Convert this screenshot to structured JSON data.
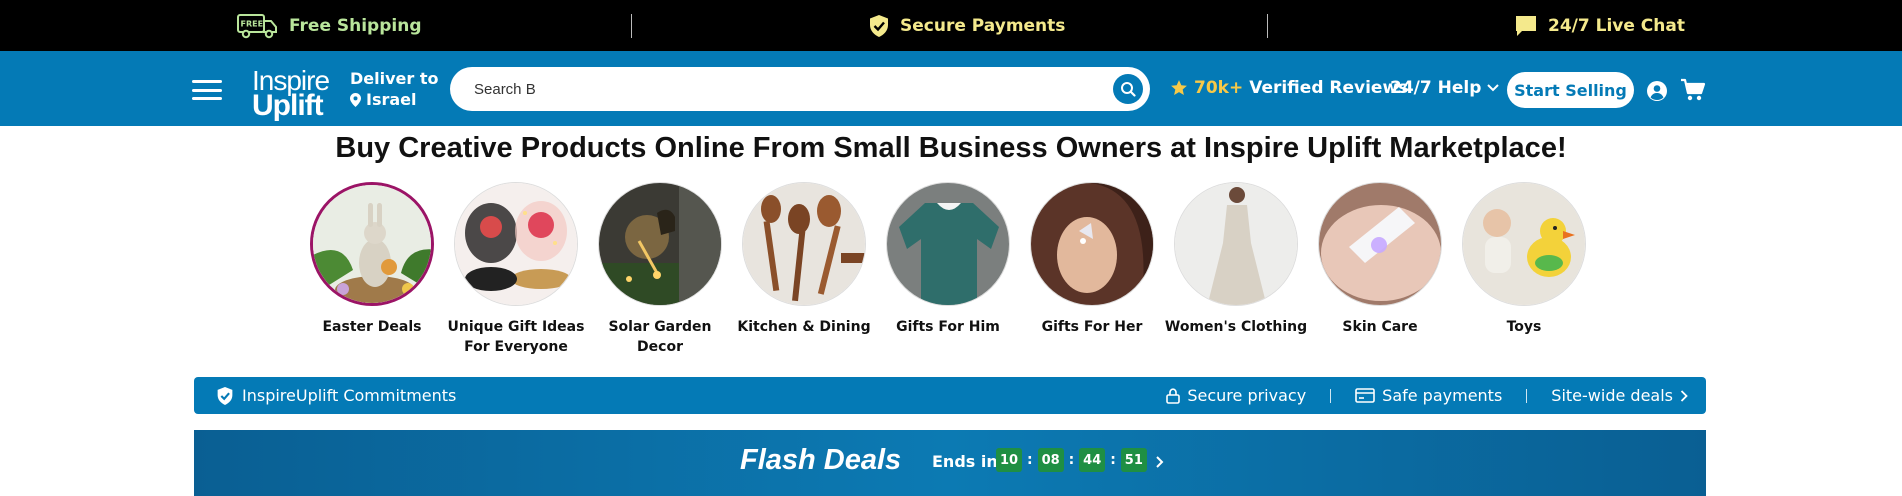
{
  "promo": {
    "free_badge": "FREE",
    "shipping": "Free Shipping",
    "secure": "Secure Payments",
    "chat": "24/7 Live Chat"
  },
  "header": {
    "logo_line1": "Inspire",
    "logo_line2": "Uplift",
    "deliver_label": "Deliver to",
    "deliver_country": "Israel",
    "search_value": "Search B",
    "reviews_count": "70k+",
    "reviews_label": "Verified Reviews",
    "help_label": "24/7 Help",
    "start_selling": "Start Selling",
    "colors": {
      "brand": "#047ab6",
      "star": "#f7c948"
    }
  },
  "headline": "Buy Creative Products Online From Small Business Owners at Inspire Uplift Marketplace!",
  "categories": [
    {
      "label": "Easter Deals",
      "icon": "easter-bunny-image"
    },
    {
      "label": "Unique Gift Ideas For Everyone",
      "icon": "gift-rose-image"
    },
    {
      "label": "Solar Garden Decor",
      "icon": "garden-lamp-image"
    },
    {
      "label": "Kitchen & Dining",
      "icon": "wooden-spoons-image"
    },
    {
      "label": "Gifts For Him",
      "icon": "sweater-image"
    },
    {
      "label": "Gifts For Her",
      "icon": "ear-cuff-image"
    },
    {
      "label": "Women's Clothing",
      "icon": "dress-image"
    },
    {
      "label": "Skin Care",
      "icon": "skin-device-image"
    },
    {
      "label": "Toys",
      "icon": "duck-toy-image"
    }
  ],
  "commitments": {
    "title": "InspireUplift Commitments",
    "privacy": "Secure privacy",
    "payments": "Safe payments",
    "deals": "Site-wide deals"
  },
  "flash": {
    "title": "Flash Deals",
    "ends_label": "Ends in",
    "timer": [
      "10",
      "08",
      "44",
      "51"
    ]
  }
}
